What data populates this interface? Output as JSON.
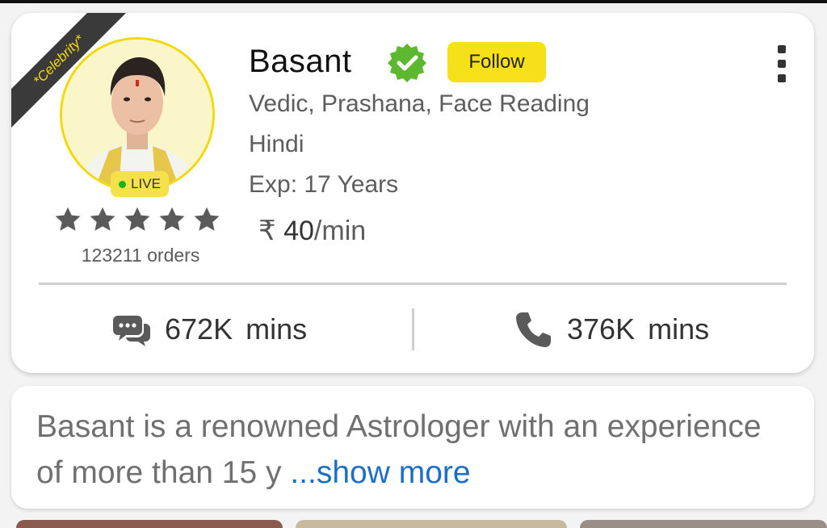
{
  "profile": {
    "ribbon": "*Celebrity*",
    "name": "Basant",
    "follow_label": "Follow",
    "live_label": "LIVE",
    "rating_stars": 5,
    "orders": "123211 orders",
    "skills": "Vedic, Prashana, Face Reading",
    "language": "Hindi",
    "experience": "Exp: 17 Years",
    "currency_symbol": "₹",
    "price_amount": "40",
    "price_unit": "/min"
  },
  "stats": {
    "chat_value": "672K",
    "chat_unit": "mins",
    "call_value": "376K",
    "call_unit": "mins"
  },
  "bio": {
    "text": "Basant is a renowned Astrologer with an experience of more than 15 y ",
    "show_more": "...show more"
  },
  "colors": {
    "accent_yellow": "#f5e019",
    "verified_green": "#5cb82e",
    "live_green": "#16b51c",
    "link_blue": "#1d6fc4"
  },
  "icons": {
    "verified": "verified-badge-icon",
    "menu": "more-vert-icon",
    "chat": "chat-bubbles-icon",
    "call": "phone-icon",
    "star": "star-icon"
  }
}
